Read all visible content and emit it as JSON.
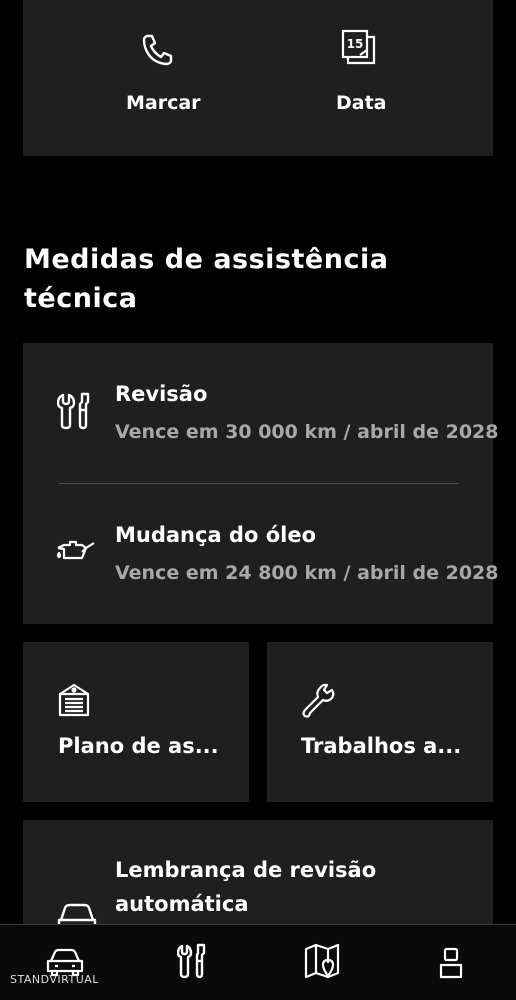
{
  "top_actions": {
    "call_label": "Marcar",
    "date_label": "Data",
    "calendar_day": "15"
  },
  "section": {
    "title": "Medidas de assistência técnica"
  },
  "service_items": [
    {
      "title": "Revisão",
      "subtitle": "Vence em 30 000 km / abril de 2028",
      "icon": "wrench-screwdriver-icon"
    },
    {
      "title": "Mudança do óleo",
      "subtitle": "Vence em 24 800 km / abril de 2028",
      "icon": "oil-can-icon"
    }
  ],
  "tiles": [
    {
      "label": "Plano de as...",
      "icon": "service-plan-icon"
    },
    {
      "label": "Trabalhos a...",
      "icon": "wrench-icon"
    }
  ],
  "reminder": {
    "title_line1": "Lembrança de revisão",
    "title_line2": "automática",
    "icon": "car-service-icon"
  },
  "bottom_nav": [
    {
      "name": "vehicle",
      "icon": "car-icon"
    },
    {
      "name": "service",
      "icon": "tools-icon"
    },
    {
      "name": "map",
      "icon": "map-icon"
    },
    {
      "name": "profile",
      "icon": "person-icon"
    }
  ],
  "watermark": "STANDVIRTUAL",
  "colors": {
    "background": "#000000",
    "card": "#1f1f1f",
    "secondary_text": "#a8a8a8"
  }
}
